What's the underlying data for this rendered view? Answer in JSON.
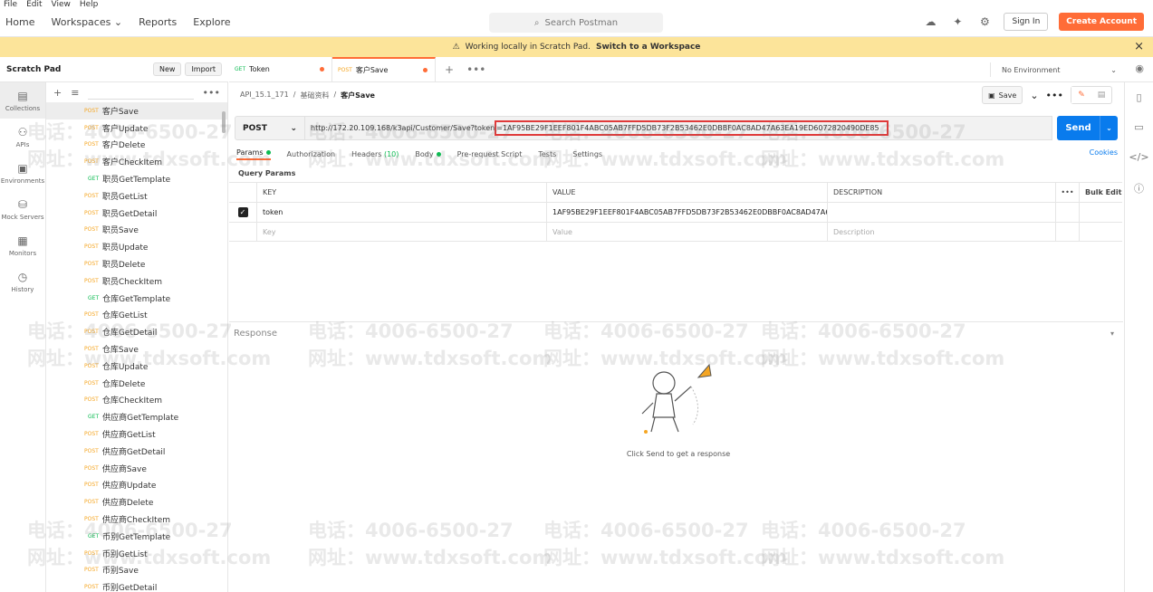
{
  "menubar": [
    "File",
    "Edit",
    "View",
    "Help"
  ],
  "nav": {
    "home": "Home",
    "workspaces": "Workspaces",
    "reports": "Reports",
    "explore": "Explore"
  },
  "search": {
    "placeholder": "Search Postman"
  },
  "auth": {
    "sign_in": "Sign In",
    "create": "Create Account"
  },
  "banner": {
    "text": "Working locally in Scratch Pad.",
    "link": "Switch to a Workspace"
  },
  "scratch": {
    "title": "Scratch Pad",
    "new": "New",
    "import": "Import"
  },
  "rail": [
    {
      "label": "Collections",
      "icon": "collections-icon"
    },
    {
      "label": "APIs",
      "icon": "apis-icon"
    },
    {
      "label": "Environments",
      "icon": "environments-icon"
    },
    {
      "label": "Mock Servers",
      "icon": "mock-servers-icon"
    },
    {
      "label": "Monitors",
      "icon": "monitors-icon"
    },
    {
      "label": "History",
      "icon": "history-icon"
    }
  ],
  "requests": [
    {
      "m": "POST",
      "n": "客户Save",
      "active": true
    },
    {
      "m": "POST",
      "n": "客户Update"
    },
    {
      "m": "POST",
      "n": "客户Delete"
    },
    {
      "m": "POST",
      "n": "客户CheckItem"
    },
    {
      "m": "GET",
      "n": "职员GetTemplate"
    },
    {
      "m": "POST",
      "n": "职员GetList"
    },
    {
      "m": "POST",
      "n": "职员GetDetail"
    },
    {
      "m": "POST",
      "n": "职员Save"
    },
    {
      "m": "POST",
      "n": "职员Update"
    },
    {
      "m": "POST",
      "n": "职员Delete"
    },
    {
      "m": "POST",
      "n": "职员CheckItem"
    },
    {
      "m": "GET",
      "n": "仓库GetTemplate"
    },
    {
      "m": "POST",
      "n": "仓库GetList"
    },
    {
      "m": "POST",
      "n": "仓库GetDetail"
    },
    {
      "m": "POST",
      "n": "仓库Save"
    },
    {
      "m": "POST",
      "n": "仓库Update"
    },
    {
      "m": "POST",
      "n": "仓库Delete"
    },
    {
      "m": "POST",
      "n": "仓库CheckItem"
    },
    {
      "m": "GET",
      "n": "供应商GetTemplate"
    },
    {
      "m": "POST",
      "n": "供应商GetList"
    },
    {
      "m": "POST",
      "n": "供应商GetDetail"
    },
    {
      "m": "POST",
      "n": "供应商Save"
    },
    {
      "m": "POST",
      "n": "供应商Update"
    },
    {
      "m": "POST",
      "n": "供应商Delete"
    },
    {
      "m": "POST",
      "n": "供应商CheckItem"
    },
    {
      "m": "GET",
      "n": "币别GetTemplate"
    },
    {
      "m": "POST",
      "n": "币别GetList"
    },
    {
      "m": "POST",
      "n": "币别Save"
    },
    {
      "m": "POST",
      "n": "币别GetDetail"
    }
  ],
  "tabs": [
    {
      "method": "GET",
      "name": "Token"
    },
    {
      "method": "POST",
      "name": "客户Save"
    }
  ],
  "environment": "No Environment",
  "breadcrumb": {
    "root": "API_15.1_171",
    "folder": "基础资料",
    "current": "客户Save"
  },
  "save_label": "Save",
  "request": {
    "method": "POST",
    "url_prefix": "http://172.20.109.168/k3api/Customer/Save?token",
    "url_token": "=1AF95BE29F1EEF801F4ABC05AB7FFD5DB73F2B53462E0DBBF0AC8AD47A63EA19ED6072820490DE85",
    "send": "Send"
  },
  "subtabs": {
    "params": "Params",
    "authorization": "Authorization",
    "headers": "Headers",
    "headers_count": "(10)",
    "body": "Body",
    "prerequest": "Pre-request Script",
    "tests": "Tests",
    "settings": "Settings",
    "cookies": "Cookies"
  },
  "query_params": {
    "title": "Query Params",
    "headers": {
      "key": "KEY",
      "value": "VALUE",
      "description": "DESCRIPTION",
      "bulk": "Bulk Edit"
    },
    "rows": [
      {
        "key": "token",
        "value": "1AF95BE29F1EEF801F4ABC05AB7FFD5DB73F2B53462E0DBBF0AC8AD47A63..."
      }
    ],
    "placeholder": {
      "key": "Key",
      "value": "Value",
      "description": "Description"
    }
  },
  "response": {
    "title": "Response",
    "empty": "Click Send to get a response"
  },
  "watermark": {
    "phone": "电话：4006-6500-27",
    "site": "网址：www.tdxsoft.com"
  }
}
